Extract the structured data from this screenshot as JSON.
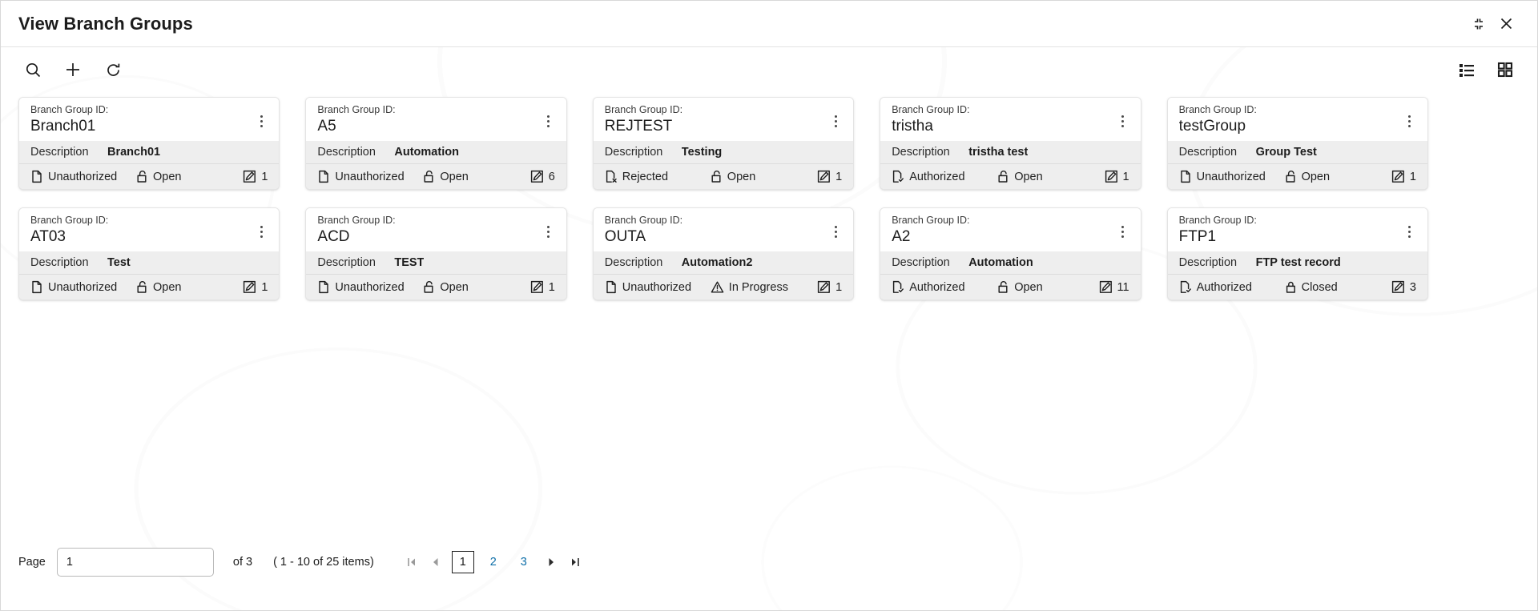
{
  "window": {
    "title": "View Branch Groups",
    "restore_icon": "restore-down-icon",
    "close_icon": "close-icon"
  },
  "toolbar": {
    "search_icon": "search-icon",
    "add_icon": "plus-icon",
    "refresh_icon": "refresh-icon",
    "list_view_icon": "list-view-icon",
    "grid_view_icon": "grid-view-icon"
  },
  "card_labels": {
    "id_label": "Branch Group ID:",
    "description_label": "Description",
    "menu_icon": "kebab-menu-icon"
  },
  "cards": [
    {
      "id": "Branch01",
      "description": "Branch01",
      "auth_status": "Unauthorized",
      "auth_icon": "document-icon",
      "lock_status": "Open",
      "lock_icon": "unlock-icon",
      "count": "1",
      "count_icon": "edit-icon"
    },
    {
      "id": "A5",
      "description": "Automation",
      "auth_status": "Unauthorized",
      "auth_icon": "document-icon",
      "lock_status": "Open",
      "lock_icon": "unlock-icon",
      "count": "6",
      "count_icon": "edit-icon"
    },
    {
      "id": "REJTEST",
      "description": "Testing",
      "auth_status": "Rejected",
      "auth_icon": "document-reject-icon",
      "lock_status": "Open",
      "lock_icon": "unlock-icon",
      "count": "1",
      "count_icon": "edit-icon"
    },
    {
      "id": "tristha",
      "description": "tristha test",
      "auth_status": "Authorized",
      "auth_icon": "document-check-icon",
      "lock_status": "Open",
      "lock_icon": "unlock-icon",
      "count": "1",
      "count_icon": "edit-icon"
    },
    {
      "id": "testGroup",
      "description": "Group Test",
      "auth_status": "Unauthorized",
      "auth_icon": "document-icon",
      "lock_status": "Open",
      "lock_icon": "unlock-icon",
      "count": "1",
      "count_icon": "edit-icon"
    },
    {
      "id": "AT03",
      "description": "Test",
      "auth_status": "Unauthorized",
      "auth_icon": "document-icon",
      "lock_status": "Open",
      "lock_icon": "unlock-icon",
      "count": "1",
      "count_icon": "edit-icon"
    },
    {
      "id": "ACD",
      "description": "TEST",
      "auth_status": "Unauthorized",
      "auth_icon": "document-icon",
      "lock_status": "Open",
      "lock_icon": "unlock-icon",
      "count": "1",
      "count_icon": "edit-icon"
    },
    {
      "id": "OUTA",
      "description": "Automation2",
      "auth_status": "Unauthorized",
      "auth_icon": "document-icon",
      "lock_status": "In Progress",
      "lock_icon": "warning-triangle-icon",
      "count": "1",
      "count_icon": "edit-icon"
    },
    {
      "id": "A2",
      "description": "Automation",
      "auth_status": "Authorized",
      "auth_icon": "document-check-icon",
      "lock_status": "Open",
      "lock_icon": "unlock-icon",
      "count": "11",
      "count_icon": "edit-icon"
    },
    {
      "id": "FTP1",
      "description": "FTP test record",
      "auth_status": "Authorized",
      "auth_icon": "document-check-icon",
      "lock_status": "Closed",
      "lock_icon": "lock-icon",
      "count": "3",
      "count_icon": "edit-icon"
    }
  ],
  "pagination": {
    "page_label": "Page",
    "page_value": "1",
    "total_label": "of 3",
    "range_label": "( 1 - 10 of 25 items)",
    "first_icon": "first-page-icon",
    "prev_icon": "prev-page-icon",
    "next_icon": "next-page-icon",
    "last_icon": "last-page-icon",
    "pages": [
      "1",
      "2",
      "3"
    ],
    "active_page": "1"
  },
  "colors": {
    "link": "#0d6ea8",
    "card_body": "#eeeeee",
    "text": "#1c1c1c"
  }
}
